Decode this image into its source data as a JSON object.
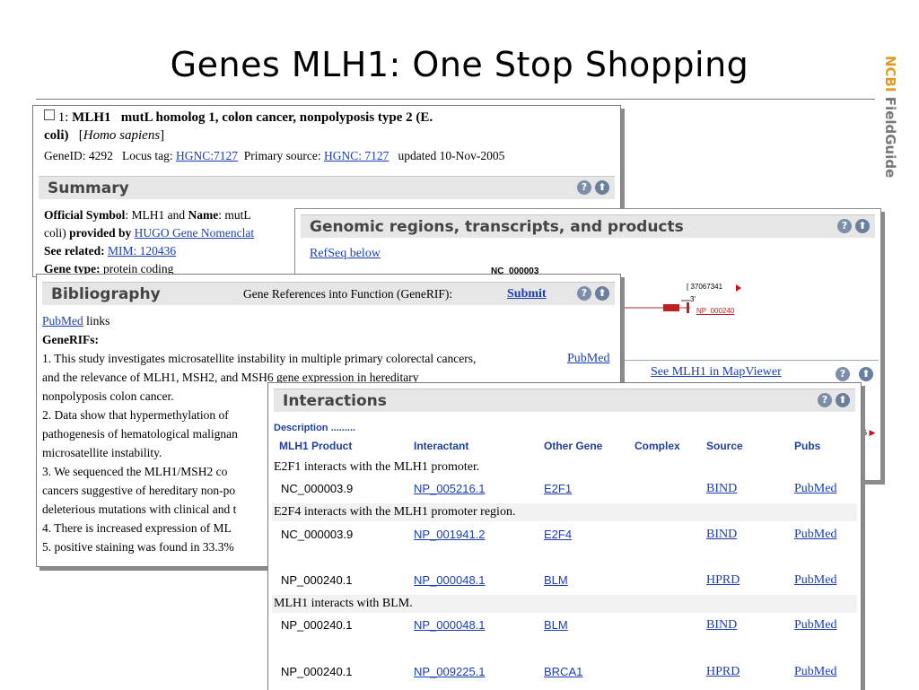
{
  "slide": {
    "title": "Genes MLH1: One Stop Shopping",
    "brand_ncbi": "NCBI",
    "brand_fieldguide": " FieldGuide"
  },
  "gene": {
    "index": "1:",
    "symbol": "MLH1",
    "name": "mutL homolog 1, colon cancer, nonpolyposis type 2 (E.",
    "name_cont": "coli)",
    "species": "Homo sapiens",
    "geneid_label": "GeneID:",
    "geneid": "4292",
    "locus_label": "Locus tag:",
    "locus_link": "HGNC:7127",
    "primary_label": "Primary source:",
    "primary_link": "HGNC: 7127",
    "updated": "updated 10-Nov-2005"
  },
  "summary": {
    "header": "Summary",
    "official_symbol_label": "Official Symbol",
    "official_symbol_text": ": MLH1 and",
    "name_label": "Name",
    "name_text": ": mutL",
    "coli_text": "coli)",
    "provided_by": "provided by",
    "provided_link": "HUGO Gene Nomenclat",
    "see_related_label": "See related:",
    "see_related_link": "MIM: 120436",
    "gene_type_label": "Gene type:",
    "gene_type_value": "protein coding"
  },
  "genomic": {
    "header": "Genomic regions, transcripts, and products",
    "refseq_link": "RefSeq below",
    "contig": "NC_000003",
    "coord_label": "[ 37067341",
    "strand_label": "3'",
    "product_link": "NP_000240",
    "mapviewer_link": "See MLH1 in MapViewer",
    "right_marker": "6"
  },
  "bibliography": {
    "header": "Bibliography",
    "generif_text": "Gene References into Function (GeneRIF):",
    "submit": "Submit",
    "pubmed_link": "PubMed",
    "links_text": "links",
    "generifs_label": "GeneRIFs:",
    "lines": [
      "1. This study investigates microsatellite instability in multiple primary colorectal cancers,",
      "and the relevance of MLH1, MSH2, and MSH6 gene expression in hereditary",
      "nonpolyposis colon cancer.",
      "2. Data show that hypermethylation of",
      "pathogenesis of hematological malignan",
      "microsatellite instability.",
      "3. We sequenced the MLH1/MSH2 co",
      "cancers suggestive of hereditary non-po",
      "deleterious mutations with clinical and t",
      "4. There is increased expression of ML",
      "5. positive staining was found in 33.3%"
    ],
    "line1_pubmed": "PubMed"
  },
  "interactions": {
    "header": "Interactions",
    "description": "Description .........",
    "columns": [
      "MLH1 Product",
      "Interactant",
      "Other Gene",
      "Complex",
      "Source",
      "Pubs"
    ],
    "groups": [
      {
        "description": "E2F1 interacts with the MLH1 promoter.",
        "row": {
          "product": "NC_000003.9",
          "interactant": "NP_005216.1",
          "gene": "E2F1",
          "source": "BIND",
          "pubs": "PubMed"
        }
      },
      {
        "description": "E2F4 interacts with the MLH1 promoter region.",
        "row": {
          "product": "NC_000003.9",
          "interactant": "NP_001941.2",
          "gene": "E2F4",
          "source": "BIND",
          "pubs": "PubMed"
        }
      },
      {
        "description": "",
        "row": {
          "product": "NP_000240.1",
          "interactant": "NP_000048.1",
          "gene": "BLM",
          "source": "HPRD",
          "pubs": "PubMed"
        }
      },
      {
        "description": "MLH1 interacts with BLM.",
        "row": {
          "product": "NP_000240.1",
          "interactant": "NP_000048.1",
          "gene": "BLM",
          "source": "BIND",
          "pubs": "PubMed"
        }
      },
      {
        "description": "",
        "row": {
          "product": "NP_000240.1",
          "interactant": "NP_009225.1",
          "gene": "BRCA1",
          "source": "HPRD",
          "pubs": "PubMed"
        }
      }
    ]
  },
  "icons": {
    "help": "?",
    "up": "⬆"
  },
  "colors": {
    "link": "#1a3db5",
    "header_bg": "#e6e6e6",
    "brand_orange": "#e59a1c",
    "brand_gray": "#777777"
  }
}
